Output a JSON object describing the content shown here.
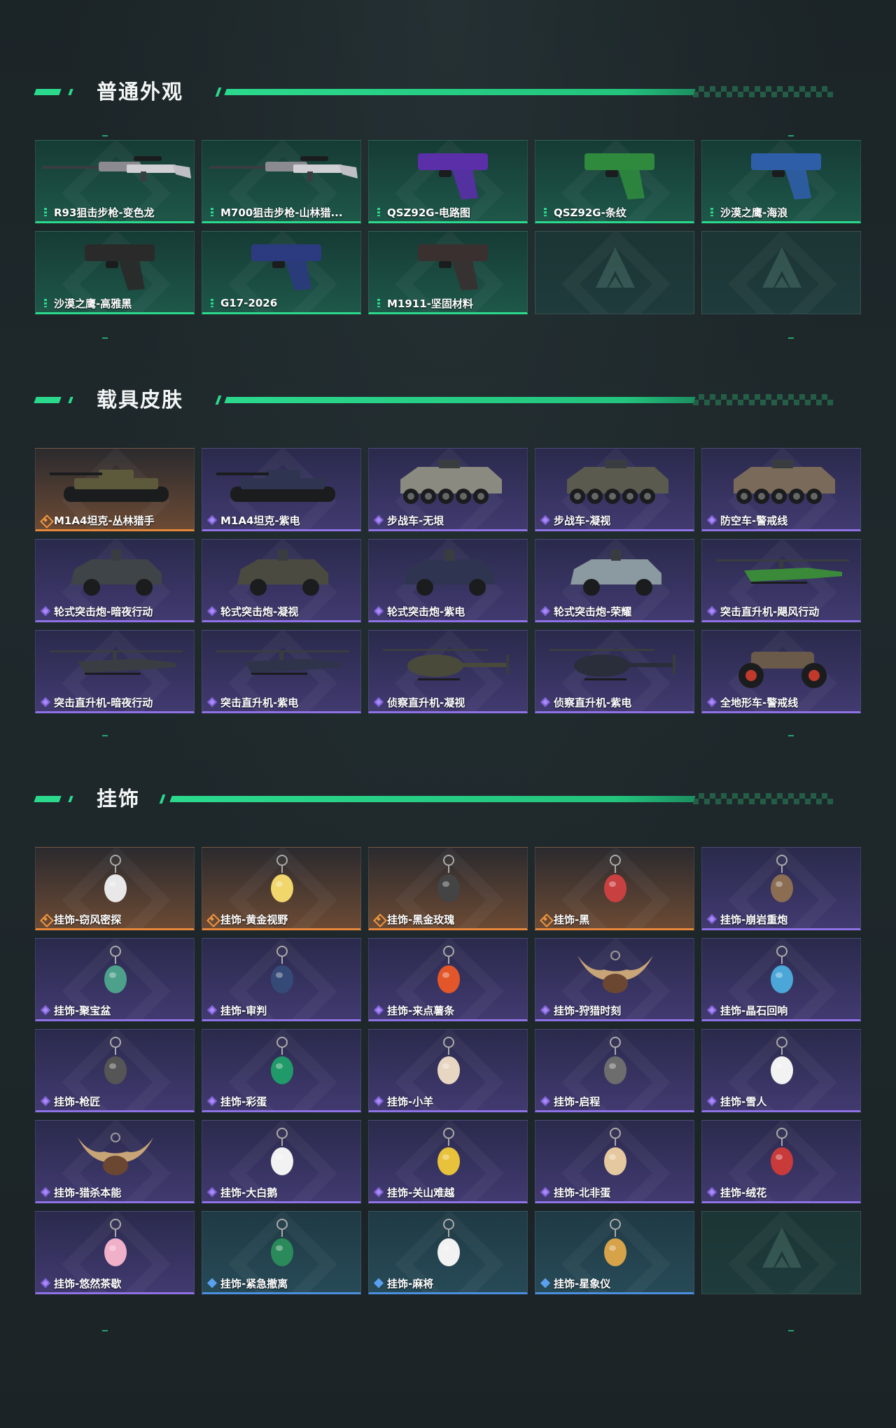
{
  "sections": {
    "skins": {
      "title": "普通外观",
      "items": [
        {
          "label": "R93狙击步枪-变色龙",
          "rarity": "g",
          "icon": "sniper-rifle-icon"
        },
        {
          "label": "M700狙击步枪-山林猎...",
          "rarity": "g",
          "icon": "sniper-rifle-icon"
        },
        {
          "label": "QSZ92G-电路图",
          "rarity": "g",
          "icon": "pistol-icon"
        },
        {
          "label": "QSZ92G-条纹",
          "rarity": "g",
          "icon": "pistol-icon"
        },
        {
          "label": "沙漠之鹰-海浪",
          "rarity": "g",
          "icon": "pistol-icon"
        },
        {
          "label": "沙漠之鹰-高雅黑",
          "rarity": "g",
          "icon": "pistol-icon"
        },
        {
          "label": "G17-2026",
          "rarity": "g",
          "icon": "pistol-icon"
        },
        {
          "label": "M1911-坚固材料",
          "rarity": "g",
          "icon": "pistol-icon"
        },
        {
          "label": "",
          "rarity": "empty",
          "icon": "placeholder-logo-icon"
        },
        {
          "label": "",
          "rarity": "empty",
          "icon": "placeholder-logo-icon"
        }
      ]
    },
    "vehicles": {
      "title": "载具皮肤",
      "items": [
        {
          "label": "M1A4坦克-丛林猎手",
          "rarity": "o",
          "icon": "tank-icon"
        },
        {
          "label": "M1A4坦克-紫电",
          "rarity": "p",
          "icon": "tank-icon"
        },
        {
          "label": "步战车-无垠",
          "rarity": "p",
          "icon": "ifv-icon"
        },
        {
          "label": "步战车-凝视",
          "rarity": "p",
          "icon": "ifv-icon"
        },
        {
          "label": "防空车-警戒线",
          "rarity": "p",
          "icon": "ifv-icon"
        },
        {
          "label": "轮式突击炮-暗夜行动",
          "rarity": "p",
          "icon": "armored-car-icon"
        },
        {
          "label": "轮式突击炮-凝视",
          "rarity": "p",
          "icon": "armored-car-icon"
        },
        {
          "label": "轮式突击炮-紫电",
          "rarity": "p",
          "icon": "armored-car-icon"
        },
        {
          "label": "轮式突击炮-荣耀",
          "rarity": "p",
          "icon": "armored-car-icon"
        },
        {
          "label": "突击直升机-飓风行动",
          "rarity": "p",
          "icon": "attack-helicopter-icon"
        },
        {
          "label": "突击直升机-暗夜行动",
          "rarity": "p",
          "icon": "attack-helicopter-icon"
        },
        {
          "label": "突击直升机-紫电",
          "rarity": "p",
          "icon": "attack-helicopter-icon"
        },
        {
          "label": "侦察直升机-凝视",
          "rarity": "p",
          "icon": "scout-helicopter-icon"
        },
        {
          "label": "侦察直升机-紫电",
          "rarity": "p",
          "icon": "scout-helicopter-icon"
        },
        {
          "label": "全地形车-警戒线",
          "rarity": "p",
          "icon": "atv-icon"
        }
      ]
    },
    "charms": {
      "title": "挂饰",
      "items": [
        {
          "label": "挂饰-窃风密探",
          "rarity": "o",
          "icon": "charm-icon"
        },
        {
          "label": "挂饰-黄金视野",
          "rarity": "o",
          "icon": "charm-icon"
        },
        {
          "label": "挂饰-黑金玫瑰",
          "rarity": "o",
          "icon": "charm-icon"
        },
        {
          "label": "挂饰-黑",
          "rarity": "o",
          "icon": "charm-icon"
        },
        {
          "label": "挂饰-崩岩重炮",
          "rarity": "p",
          "icon": "charm-icon"
        },
        {
          "label": "挂饰-聚宝盆",
          "rarity": "p",
          "icon": "charm-icon"
        },
        {
          "label": "挂饰-审判",
          "rarity": "p",
          "icon": "charm-icon"
        },
        {
          "label": "挂饰-来点薯条",
          "rarity": "p",
          "icon": "charm-icon"
        },
        {
          "label": "挂饰-狩猎时刻",
          "rarity": "p",
          "icon": "antler-charm-icon"
        },
        {
          "label": "挂饰-晶石回响",
          "rarity": "p",
          "icon": "charm-icon"
        },
        {
          "label": "挂饰-枪匠",
          "rarity": "p",
          "icon": "charm-icon"
        },
        {
          "label": "挂饰-彩蛋",
          "rarity": "p",
          "icon": "charm-icon"
        },
        {
          "label": "挂饰-小羊",
          "rarity": "p",
          "icon": "charm-icon"
        },
        {
          "label": "挂饰-启程",
          "rarity": "p",
          "icon": "charm-icon"
        },
        {
          "label": "挂饰-雪人",
          "rarity": "p",
          "icon": "charm-icon"
        },
        {
          "label": "挂饰-猎杀本能",
          "rarity": "p",
          "icon": "antler-charm-icon"
        },
        {
          "label": "挂饰-大白鹅",
          "rarity": "p",
          "icon": "charm-icon"
        },
        {
          "label": "挂饰-关山难越",
          "rarity": "p",
          "icon": "charm-icon"
        },
        {
          "label": "挂饰-北非蛋",
          "rarity": "p",
          "icon": "charm-icon"
        },
        {
          "label": "挂饰-绒花",
          "rarity": "p",
          "icon": "charm-icon"
        },
        {
          "label": "挂饰-悠然茶歇",
          "rarity": "p",
          "icon": "charm-icon"
        },
        {
          "label": "挂饰-紧急撤离",
          "rarity": "b",
          "icon": "charm-icon"
        },
        {
          "label": "挂饰-麻将",
          "rarity": "b",
          "icon": "charm-icon"
        },
        {
          "label": "挂饰-星象仪",
          "rarity": "b",
          "icon": "charm-icon"
        },
        {
          "label": "",
          "rarity": "empty",
          "icon": "placeholder-logo-icon"
        }
      ]
    }
  },
  "colors": {
    "accent": "#2bd98d",
    "purple": "#8f72e6",
    "orange": "#e6873b",
    "blue": "#4a8fe0"
  }
}
